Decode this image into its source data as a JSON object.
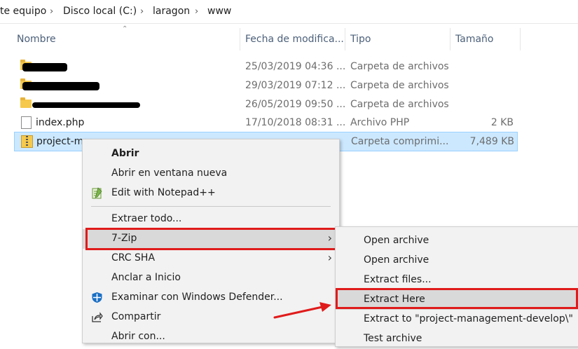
{
  "breadcrumb": {
    "items": [
      "te equipo",
      "Disco local (C:)",
      "laragon",
      "www"
    ],
    "separator_icon": "chevron-right-icon"
  },
  "columns": [
    "Nombre",
    "Fecha de modifica...",
    "Tipo",
    "Tamaño"
  ],
  "files": [
    {
      "name": "",
      "date": "25/03/2019 04:36 ...",
      "type": "Carpeta de archivos",
      "size": "",
      "icon": "folder-icon",
      "redacted": true
    },
    {
      "name": "",
      "date": "29/03/2019 07:12 ...",
      "type": "Carpeta de archivos",
      "size": "",
      "icon": "folder-icon",
      "redacted": true
    },
    {
      "name": "",
      "date": "26/05/2019 09:50 ...",
      "type": "Carpeta de archivos",
      "size": "",
      "icon": "folder-icon",
      "redacted": true
    },
    {
      "name": "index.php",
      "date": "17/10/2018 08:31 ...",
      "type": "Archivo PHP",
      "size": "2 KB",
      "icon": "php-file-icon"
    },
    {
      "name": "project-m",
      "date": "",
      "type": "Carpeta comprimi...",
      "size": "7,489 KB",
      "icon": "zip-folder-icon",
      "selected": true
    }
  ],
  "context_menu": {
    "items": [
      {
        "label": "Abrir",
        "bold": true
      },
      {
        "label": "Abrir en ventana nueva"
      },
      {
        "label": "Edit with Notepad++",
        "icon": "notepad-plus-plus-icon"
      },
      {
        "label": "Extraer todo..."
      },
      {
        "label": "7-Zip",
        "submenu": true,
        "highlighted": true
      },
      {
        "label": "CRC SHA",
        "submenu": true
      },
      {
        "label": "Anclar a Inicio"
      },
      {
        "label": "Examinar con Windows Defender...",
        "icon": "windows-defender-icon"
      },
      {
        "label": "Compartir",
        "icon": "share-icon"
      },
      {
        "label": "Abrir con..."
      }
    ]
  },
  "submenu_7zip": {
    "items": [
      {
        "label": "Open archive"
      },
      {
        "label": "Open archive"
      },
      {
        "label": "Extract files..."
      },
      {
        "label": "Extract Here",
        "highlighted": true
      },
      {
        "label": "Extract to \"project-management-develop\\\""
      },
      {
        "label": "Test archive"
      }
    ]
  },
  "colors": {
    "highlight_box": "#e01b1b",
    "selection": "#cce8ff",
    "menu_bg": "#f2f2f2"
  }
}
